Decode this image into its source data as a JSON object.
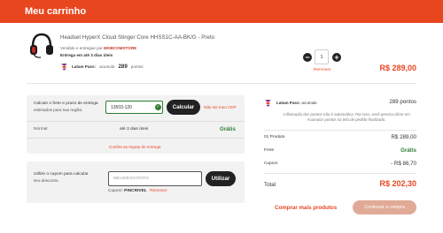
{
  "header": {
    "title": "Meu carrinho"
  },
  "product": {
    "name": "Headset HyperX Cloud Stinger Core HHSS1C-AA-BK/G - Preto",
    "seller_prefix": "Vendido e entregue por",
    "seller": "MOBCOMSTORE",
    "delivery": "Entrega em até 3 dias úteis",
    "latam_label": "Latam Pass:",
    "latam_sub": "acumule",
    "latam_points": "289",
    "latam_points_unit": "pontos",
    "quantity": "1",
    "remove_label": "Remover",
    "price": "R$ 289,00"
  },
  "shipping": {
    "title": "Calcule o frete e prazo de entrega",
    "subtitle": "estimados para sua região.",
    "cep_value": "13503-120",
    "calc_button": "Calcular",
    "cep_link": "Não sei meu CEP",
    "type": "Normal",
    "eta": "até 3 dias úteis",
    "price": "Grátis",
    "rules_link": "Confira as regras de entrega"
  },
  "coupon": {
    "title": "Utilize o cupom para calcular",
    "subtitle": "seu desconto.",
    "placeholder": "MEUDESCONTO",
    "apply_button": "Utilizar",
    "applied_prefix": "Cupom:",
    "applied_code": "PINCRIVEL",
    "remove_label": "Remover"
  },
  "summary": {
    "latam_label": "Latam Pass:",
    "latam_sub": "acumule",
    "latam_points": "289 pontos",
    "note": "A liberação dos pontos não é automática. Por isso, você precisa clicar em Acumular pontos na tela de pedido finalizado.",
    "products_label": "01 Produto",
    "products_value": "R$ 289,00",
    "freight_label": "Frete",
    "freight_value": "Grátis",
    "coupon_label": "Cupom",
    "coupon_value": "- R$ 86,70",
    "total_label": "Total",
    "total_value": "R$ 202,30",
    "continue_link": "Comprar mais produtos",
    "checkout_button": "Continuar a compra"
  },
  "colors": {
    "brand": "#e8461f",
    "success": "#2e7d32",
    "latam": "#7b2d8e"
  }
}
